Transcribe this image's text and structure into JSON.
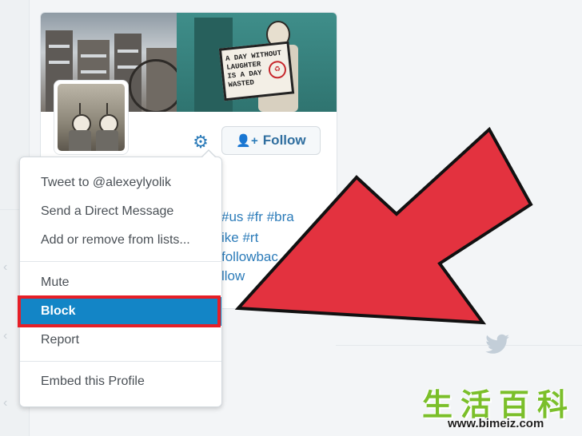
{
  "profile_card": {
    "banner": {
      "sign_lines": [
        "A DAY WITHOUT",
        "LAUGHTER",
        "IS A DAY",
        "WASTED"
      ],
      "recycle_icon": "recycle-icon"
    },
    "avatar_icon": "avatar-photo",
    "gear_icon": "gear-icon",
    "follow_button": {
      "icon": "add-user-icon",
      "label": "Follow"
    },
    "bio_fragments": [
      "#us #fr #bra",
      "ike #rt",
      "followbac",
      "llow"
    ]
  },
  "dropdown_menu": {
    "items": [
      {
        "label": "Tweet to @alexeylyolik"
      },
      {
        "label": "Send a Direct Message"
      },
      {
        "label": "Add or remove from lists..."
      },
      {
        "label": "Mute"
      },
      {
        "label": "Block",
        "selected": true
      },
      {
        "label": "Report"
      },
      {
        "label": "Embed this Profile"
      }
    ]
  },
  "annotations": {
    "arrow_color": "#e3323f",
    "highlight_color": "#e61f27"
  },
  "watermark": {
    "chars": "生活百科",
    "url": "www.bimeiz.com"
  },
  "colors": {
    "accent": "#1385c6",
    "link": "#2b7bb9"
  }
}
